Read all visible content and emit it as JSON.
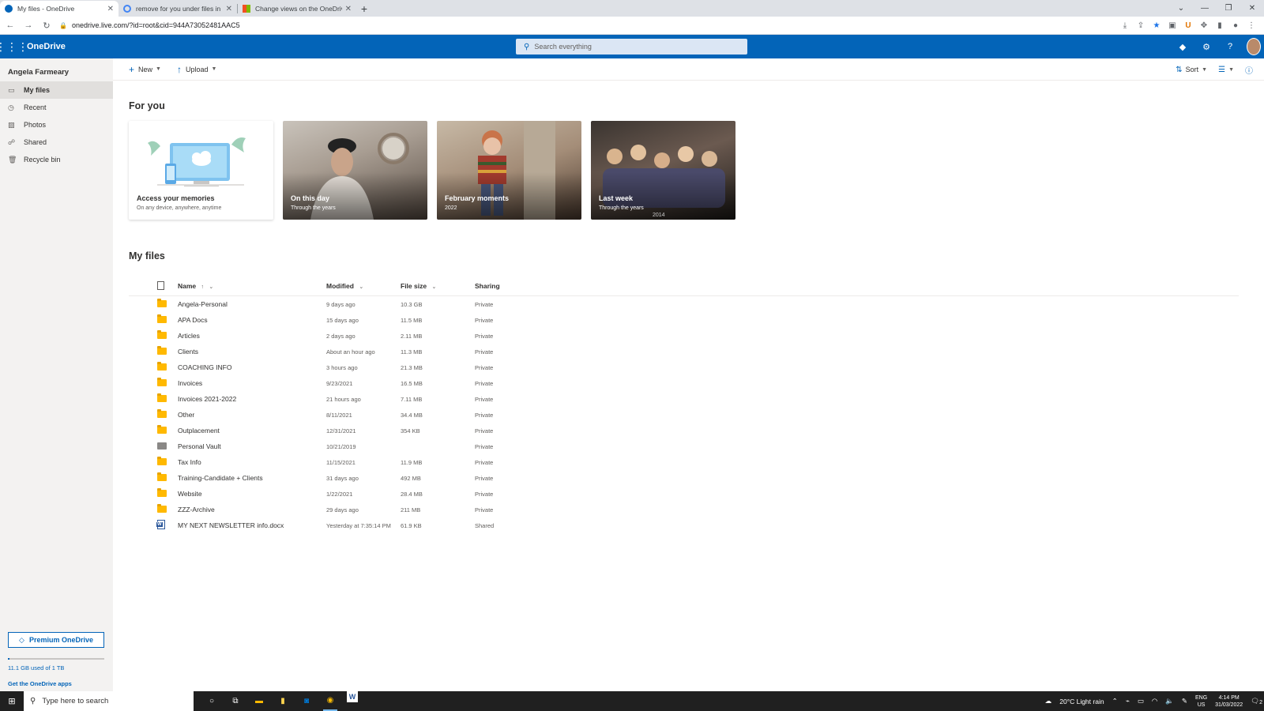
{
  "browser": {
    "tabs": [
      {
        "title": "My files - OneDrive",
        "active": true
      },
      {
        "title": "remove for you under files in one",
        "active": false
      },
      {
        "title": "Change views on the OneDrive w",
        "active": false
      }
    ],
    "url": "onedrive.live.com/?id=root&cid=944A73052481AAC5"
  },
  "header": {
    "brand": "OneDrive",
    "search_placeholder": "Search everything",
    "accent": "#0364b8"
  },
  "sidebar": {
    "user": "Angela Farmeary",
    "items": [
      {
        "label": "My files",
        "icon": "folder-icon",
        "active": true
      },
      {
        "label": "Recent",
        "icon": "clock-icon",
        "active": false
      },
      {
        "label": "Photos",
        "icon": "image-icon",
        "active": false
      },
      {
        "label": "Shared",
        "icon": "people-icon",
        "active": false
      },
      {
        "label": "Recycle bin",
        "icon": "trash-icon",
        "active": false
      }
    ],
    "premium": "Premium OneDrive",
    "storage": "11.1 GB used of 1 TB",
    "get_apps": "Get the OneDrive apps"
  },
  "commandbar": {
    "new": "New",
    "upload": "Upload",
    "sort": "Sort"
  },
  "for_you": {
    "heading": "For you",
    "cards": [
      {
        "title": "Access your memories",
        "subtitle": "On any device, anywhere, anytime"
      },
      {
        "title": "On this day",
        "subtitle": "Through the years"
      },
      {
        "title": "February moments",
        "subtitle": "2022"
      },
      {
        "title": "Last week",
        "subtitle": "Through the years",
        "stamp": "2014"
      }
    ]
  },
  "files": {
    "heading": "My files",
    "columns": {
      "name": "Name",
      "sort_arrow": "↑",
      "modified": "Modified",
      "size": "File size",
      "sharing": "Sharing"
    },
    "rows": [
      {
        "type": "folder",
        "name": "Angela-Personal",
        "modified": "9 days ago",
        "size": "10.3 GB",
        "sharing": "Private"
      },
      {
        "type": "folder",
        "name": "APA Docs",
        "modified": "15 days ago",
        "size": "11.5 MB",
        "sharing": "Private"
      },
      {
        "type": "folder",
        "name": "Articles",
        "modified": "2 days ago",
        "size": "2.11 MB",
        "sharing": "Private"
      },
      {
        "type": "folder",
        "name": "Clients",
        "modified": "About an hour ago",
        "size": "11.3 MB",
        "sharing": "Private"
      },
      {
        "type": "folder",
        "name": "COACHING INFO",
        "modified": "3 hours ago",
        "size": "21.3 MB",
        "sharing": "Private"
      },
      {
        "type": "folder",
        "name": "Invoices",
        "modified": "9/23/2021",
        "size": "16.5 MB",
        "sharing": "Private"
      },
      {
        "type": "folder",
        "name": "Invoices 2021-2022",
        "modified": "21 hours ago",
        "size": "7.11 MB",
        "sharing": "Private"
      },
      {
        "type": "folder",
        "name": "Other",
        "modified": "8/11/2021",
        "size": "34.4 MB",
        "sharing": "Private"
      },
      {
        "type": "folder",
        "name": "Outplacement",
        "modified": "12/31/2021",
        "size": "354 KB",
        "sharing": "Private"
      },
      {
        "type": "vault",
        "name": "Personal Vault",
        "modified": "10/21/2019",
        "size": "",
        "sharing": "Private"
      },
      {
        "type": "folder",
        "name": "Tax Info",
        "modified": "11/15/2021",
        "size": "11.9 MB",
        "sharing": "Private"
      },
      {
        "type": "folder",
        "name": "Training-Candidate + Clients",
        "modified": "31 days ago",
        "size": "492 MB",
        "sharing": "Private"
      },
      {
        "type": "folder",
        "name": "Website",
        "modified": "1/22/2021",
        "size": "28.4 MB",
        "sharing": "Private"
      },
      {
        "type": "folder",
        "name": "ZZZ-Archive",
        "modified": "29 days ago",
        "size": "211 MB",
        "sharing": "Private"
      },
      {
        "type": "docx",
        "name": "MY NEXT NEWSLETTER info.docx",
        "modified": "Yesterday at 7:35:14 PM",
        "size": "61.9 KB",
        "sharing": "Shared"
      }
    ]
  },
  "taskbar": {
    "search_placeholder": "Type here to search",
    "weather": "20°C  Light rain",
    "lang": "ENG",
    "region": "US",
    "time": "4:14 PM",
    "date": "31/03/2022",
    "notifications": "2"
  }
}
